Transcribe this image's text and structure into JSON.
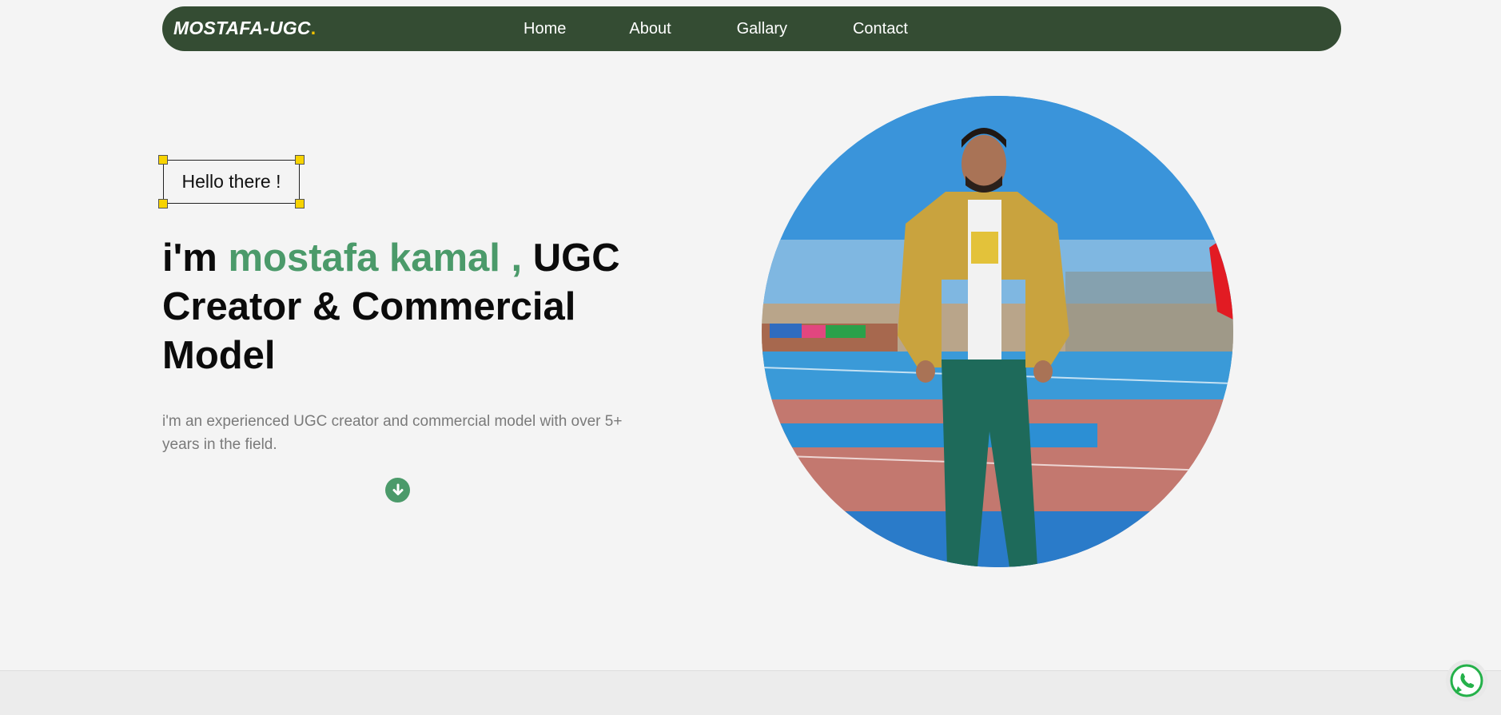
{
  "nav": {
    "logo_text": "MOSTAFA-UGC",
    "logo_dot": ".",
    "links": [
      {
        "label": "Home"
      },
      {
        "label": "About"
      },
      {
        "label": "Gallary"
      },
      {
        "label": "Contact"
      }
    ]
  },
  "hero": {
    "greeting": "Hello there !",
    "headline_prefix": "i'm ",
    "headline_name": "mostafa kamal ,",
    "headline_suffix": " UGC Creator & Commercial Model",
    "intro": "i'm an experienced UGC creator and commercial model with over 5+ years in the field.",
    "scroll_icon": "arrow-down-circle-icon",
    "portrait_icon": "portrait-photo"
  },
  "floating": {
    "whatsapp_icon": "whatsapp-icon"
  },
  "colors": {
    "nav_bg": "#344c33",
    "accent": "#4b9a6a",
    "logo_dot": "#f2c200",
    "page_bg": "#f4f4f4"
  }
}
